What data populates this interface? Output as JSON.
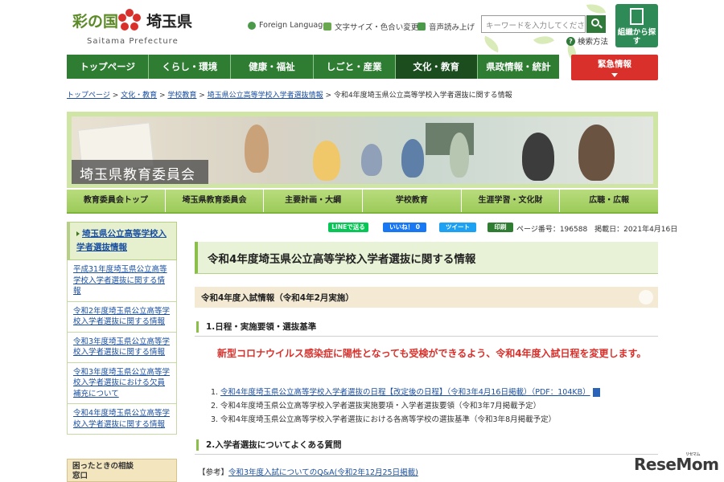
{
  "header": {
    "logo_prefix": "彩の国",
    "logo_name": "埼玉県",
    "logo_sub": "Saitama Prefecture",
    "util_foreign": "Foreign Language",
    "util_fontsize": "文字サイズ・色合い変更",
    "util_voice": "音声読み上げ",
    "search_placeholder": "キーワードを入力してください",
    "search_help": "検索方法",
    "org_button": "組織から探す"
  },
  "global_nav": [
    "トップページ",
    "くらし・環境",
    "健康・福祉",
    "しごと・産業",
    "文化・教育",
    "県政情報・統計"
  ],
  "global_nav_active": 4,
  "urgent": "緊急情報",
  "breadcrumb": {
    "items": [
      "トップページ",
      "文化・教育",
      "学校教育",
      "埼玉県公立高等学校入学者選抜情報"
    ],
    "current": "令和4年度埼玉県公立高等学校入学者選抜に関する情報",
    "sep": " > "
  },
  "banner": {
    "title": "埼玉県教育委員会"
  },
  "sub_nav": [
    "教育委員会トップ",
    "埼玉県教育委員会",
    "主要計画・大綱",
    "学校教育",
    "生涯学習・文化財",
    "広聴・広報"
  ],
  "side_nav": {
    "head": "埼玉県公立高等学校入学者選抜情報",
    "items": [
      "平成31年度埼玉県公立高等学校入学者選抜に関する情報",
      "令和2年度埼玉県公立高等学校入学者選抜に関する情報",
      "令和3年度埼玉県公立高等学校入学者選抜に関する情報",
      "令和3年度埼玉県公立高等学校入学者選抜における欠員補充について",
      "令和4年度埼玉県公立高等学校入学者選抜に関する情報"
    ],
    "help": "困ったときの相談窓口"
  },
  "share": {
    "line": "LINEで送る",
    "like": "いいね！ 0",
    "tweet": "ツイート",
    "print": "印刷"
  },
  "page_meta": "ページ番号：196588　掲載日：2021年4月16日",
  "content": {
    "title": "令和4年度埼玉県公立高等学校入学者選抜に関する情報",
    "section": "令和4年度入試情報（令和4年2月実施）",
    "h3_1": "1.日程・実施要領・選抜基準",
    "notice": "新型コロナウイルス感染症に陽性となっても受検ができるよう、令和4年度入試日程を変更します。",
    "list": [
      {
        "num": "1.",
        "text": "令和4年度埼玉県公立高等学校入学者選抜の日程【改定後の日程】（令和3年4月16日掲載）（PDF：104KB）",
        "link": true
      },
      {
        "num": "2.",
        "text": "令和4年度埼玉県公立高等学校入学者選抜実施要項・入学者選抜要領（令和3年7月掲載予定）",
        "link": false
      },
      {
        "num": "3.",
        "text": "令和4年度埼玉県公立高等学校入学者選抜における各高等学校の選抜基準（令和3年8月掲載予定）",
        "link": false
      }
    ],
    "h3_2": "2.入学者選抜についてよくある質問",
    "ref_label": "【参考】",
    "ref_link": "令和3年度入試についてのQ&A(令和2年12月25日掲載)"
  },
  "watermark": {
    "main": "ReseMom",
    "sub": "リセマム"
  },
  "colors": {
    "primary_green": "#2e7d32",
    "urgent_red": "#d9302b",
    "notice_red": "#d9302b",
    "link_blue": "#1a4fa0"
  }
}
